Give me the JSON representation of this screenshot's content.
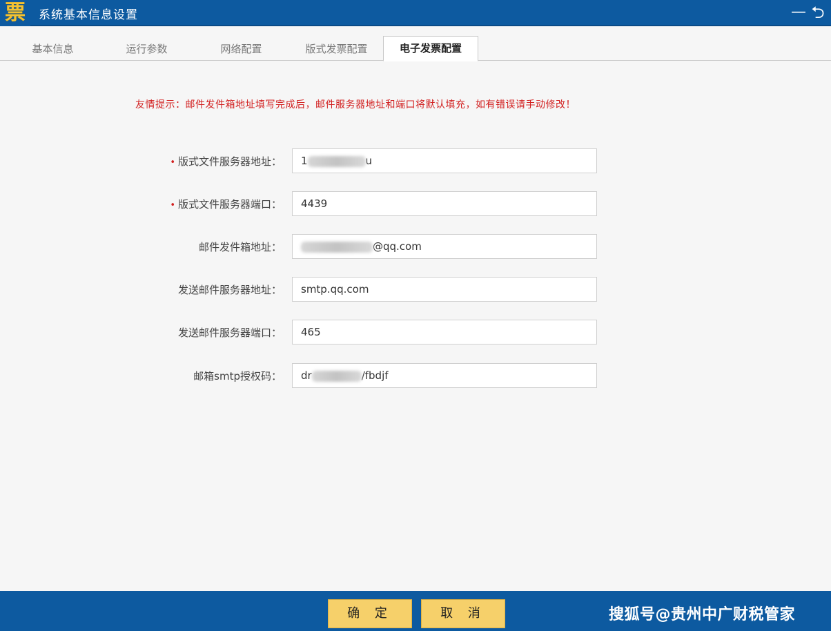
{
  "window": {
    "logo_char": "票",
    "title": "系统基本信息设置",
    "minimize_glyph": "—",
    "back_glyph": "⮌"
  },
  "tabs": [
    {
      "label": "基本信息",
      "active": false
    },
    {
      "label": "运行参数",
      "active": false
    },
    {
      "label": "网络配置",
      "active": false
    },
    {
      "label": "版式发票配置",
      "active": false
    },
    {
      "label": "电子发票配置",
      "active": true
    }
  ],
  "hint": "友情提示：邮件发件箱地址填写完成后，邮件服务器地址和端口将默认填充，如有错误请手动修改！",
  "form": {
    "rows": [
      {
        "required": true,
        "label": "版式文件服务器地址：",
        "value_prefix": "1",
        "value_suffix": "u"
      },
      {
        "required": true,
        "label": "版式文件服务器端口：",
        "value": "4439"
      },
      {
        "required": false,
        "label": "邮件发件箱地址：",
        "value_prefix": "",
        "value_suffix": "@qq.com"
      },
      {
        "required": false,
        "label": "发送邮件服务器地址：",
        "value": "smtp.qq.com"
      },
      {
        "required": false,
        "label": "发送邮件服务器端口：",
        "value": "465"
      },
      {
        "required": false,
        "label": "邮箱smtp授权码：",
        "value_prefix": "dr",
        "value_suffix": "/fbdjf"
      }
    ]
  },
  "buttons": {
    "ok": "确 定",
    "cancel": "取 消"
  },
  "watermark": "搜狐号@贵州中广财税管家",
  "colors": {
    "titlebar": "#0d5aa0",
    "button": "#f6d06a",
    "hint": "#d22020",
    "logo": "#f4c232"
  }
}
